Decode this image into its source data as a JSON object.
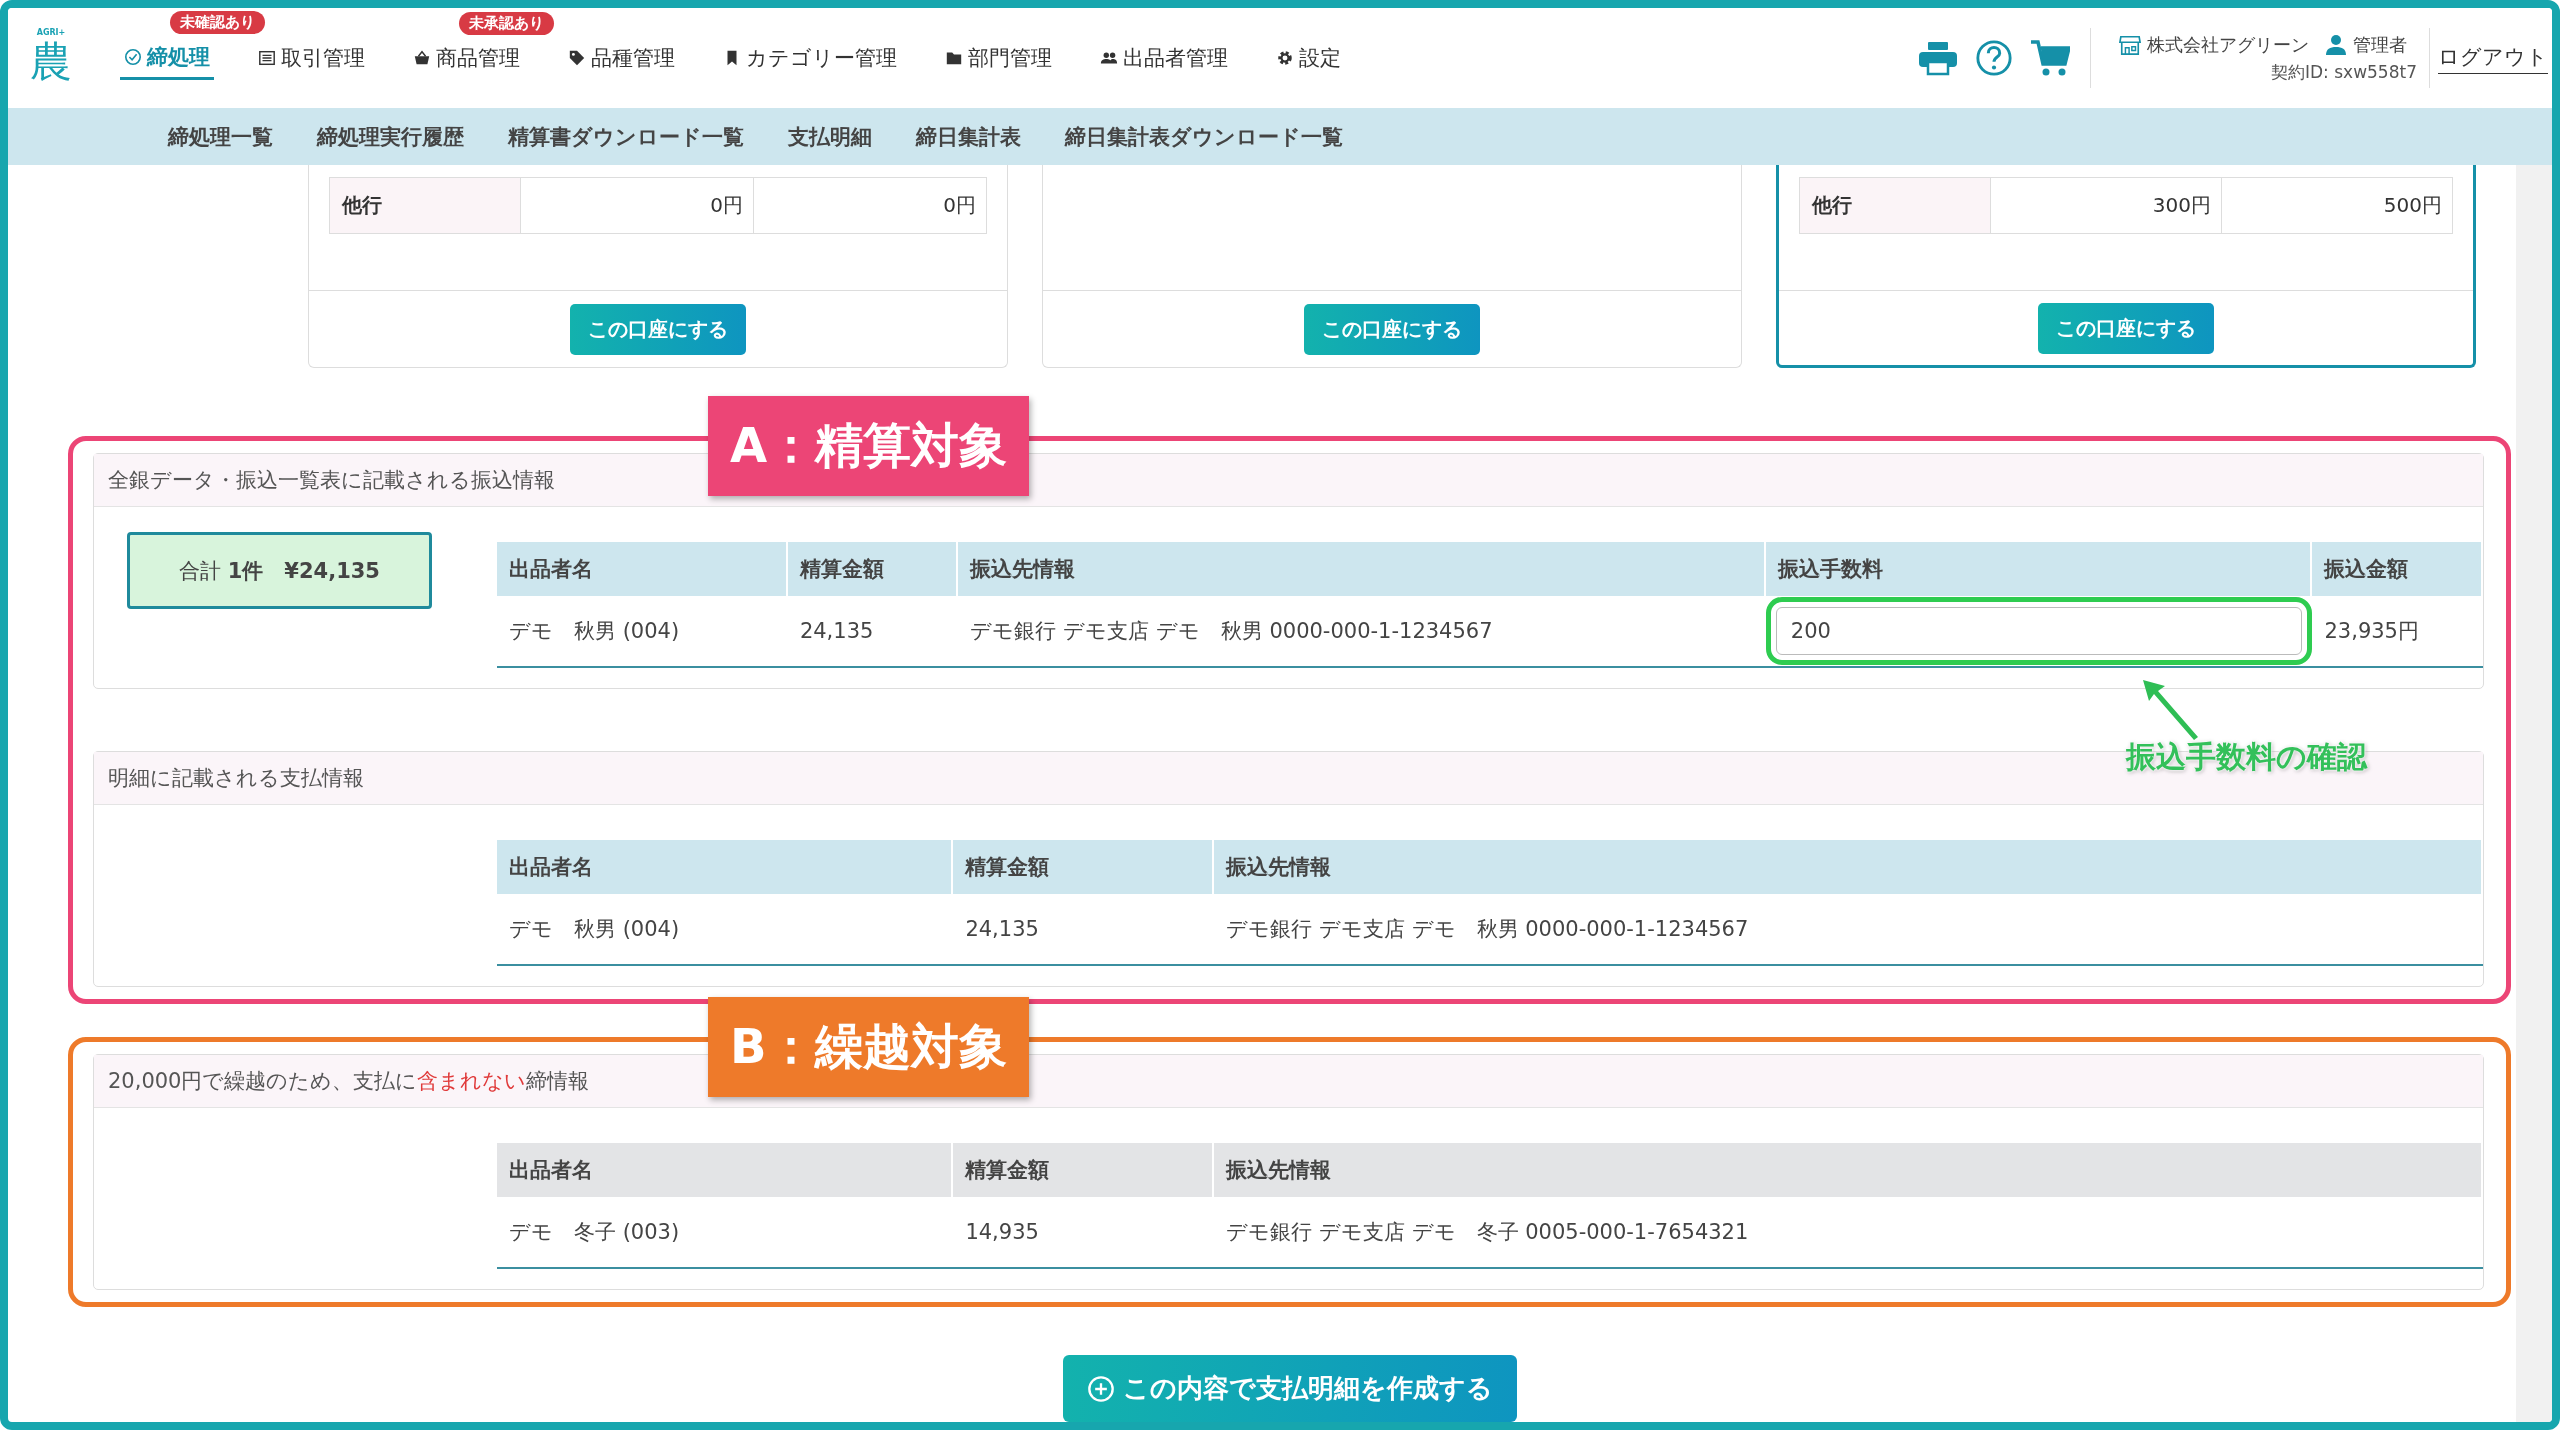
{
  "header": {
    "logo": {
      "mark": "農",
      "tag": "AGRI+"
    },
    "nav": [
      {
        "label": "締処理",
        "selected": true,
        "badge": "未確認あり"
      },
      {
        "label": "取引管理",
        "selected": false
      },
      {
        "label": "商品管理",
        "selected": false,
        "badge": "未承認あり"
      },
      {
        "label": "品種管理",
        "selected": false
      },
      {
        "label": "カテゴリー管理",
        "selected": false
      },
      {
        "label": "部門管理",
        "selected": false
      },
      {
        "label": "出品者管理",
        "selected": false
      },
      {
        "label": "設定",
        "selected": false
      }
    ],
    "company": "株式会社アグリーン",
    "user": "管理者",
    "contract_id": "契約ID: sxw558t7",
    "logout": "ログアウト"
  },
  "subnav": [
    "締処理一覧",
    "締処理実行履歴",
    "精算書ダウンロード一覧",
    "支払明細",
    "締日集計表",
    "締日集計表ダウンロード一覧"
  ],
  "accounts": [
    {
      "rows": [
        {
          "label": "他行",
          "values": [
            "0円",
            "0円"
          ]
        }
      ],
      "button": "この口座にする",
      "selected": false
    },
    {
      "button": "この口座にする",
      "selected": false
    },
    {
      "rows": [
        {
          "label": "他行",
          "values": [
            "300円",
            "500円"
          ]
        }
      ],
      "button": "この口座にする",
      "selected": true
    }
  ],
  "sections": [
    {
      "label": "A：精算対象",
      "color": "#ec4576",
      "panels": [
        {
          "title_parts": [
            {
              "text": "全銀データ・振込一覧表に記載される振込情報",
              "emphasis": false
            }
          ],
          "summary": "合計 **1件**　**¥24,135**",
          "table": {
            "muted": false,
            "kind": "transfer",
            "columns": [
              "出品者名",
              "精算金額",
              "振込先情報",
              "振込手数料",
              "振込金額"
            ],
            "rows": [
              {
                "cells": [
                  {
                    "kind": "text",
                    "text": "デモ　秋男 (004)"
                  },
                  {
                    "kind": "text",
                    "text": "24,135"
                  },
                  {
                    "kind": "text",
                    "text": "デモ銀行 デモ支店 デモ　秋男 0000-000-1-1234567"
                  },
                  {
                    "kind": "input",
                    "text": "200",
                    "callout": "振込手数料の確認"
                  },
                  {
                    "kind": "text",
                    "text": "23,935円"
                  }
                ]
              }
            ]
          }
        },
        {
          "title_parts": [
            {
              "text": "明細に記載される支払情報",
              "emphasis": false
            }
          ],
          "table": {
            "muted": false,
            "kind": "payment",
            "columns": [
              "出品者名",
              "精算金額",
              "振込先情報"
            ],
            "rows": [
              {
                "cells": [
                  {
                    "kind": "text",
                    "text": "デモ　秋男 (004)"
                  },
                  {
                    "kind": "text",
                    "text": "24,135"
                  },
                  {
                    "kind": "text",
                    "text": "デモ銀行 デモ支店 デモ　秋男 0000-000-1-1234567"
                  }
                ]
              }
            ]
          }
        }
      ]
    },
    {
      "label": "B：繰越対象",
      "color": "#ee7a2a",
      "panels": [
        {
          "title_parts": [
            {
              "text": "20,000円で繰越のため、支払に",
              "emphasis": false
            },
            {
              "text": "含まれない",
              "emphasis": true
            },
            {
              "text": "締情報",
              "emphasis": false
            }
          ],
          "table": {
            "muted": true,
            "kind": "payment",
            "columns": [
              "出品者名",
              "精算金額",
              "振込先情報"
            ],
            "rows": [
              {
                "cells": [
                  {
                    "kind": "text",
                    "text": "デモ　冬子 (003)"
                  },
                  {
                    "kind": "text",
                    "text": "14,935"
                  },
                  {
                    "kind": "text",
                    "text": "デモ銀行 デモ支店 デモ　冬子 0005-000-1-7654321"
                  }
                ]
              }
            ]
          }
        }
      ]
    }
  ],
  "submit": {
    "label": "この内容で支払明細を作成する"
  }
}
